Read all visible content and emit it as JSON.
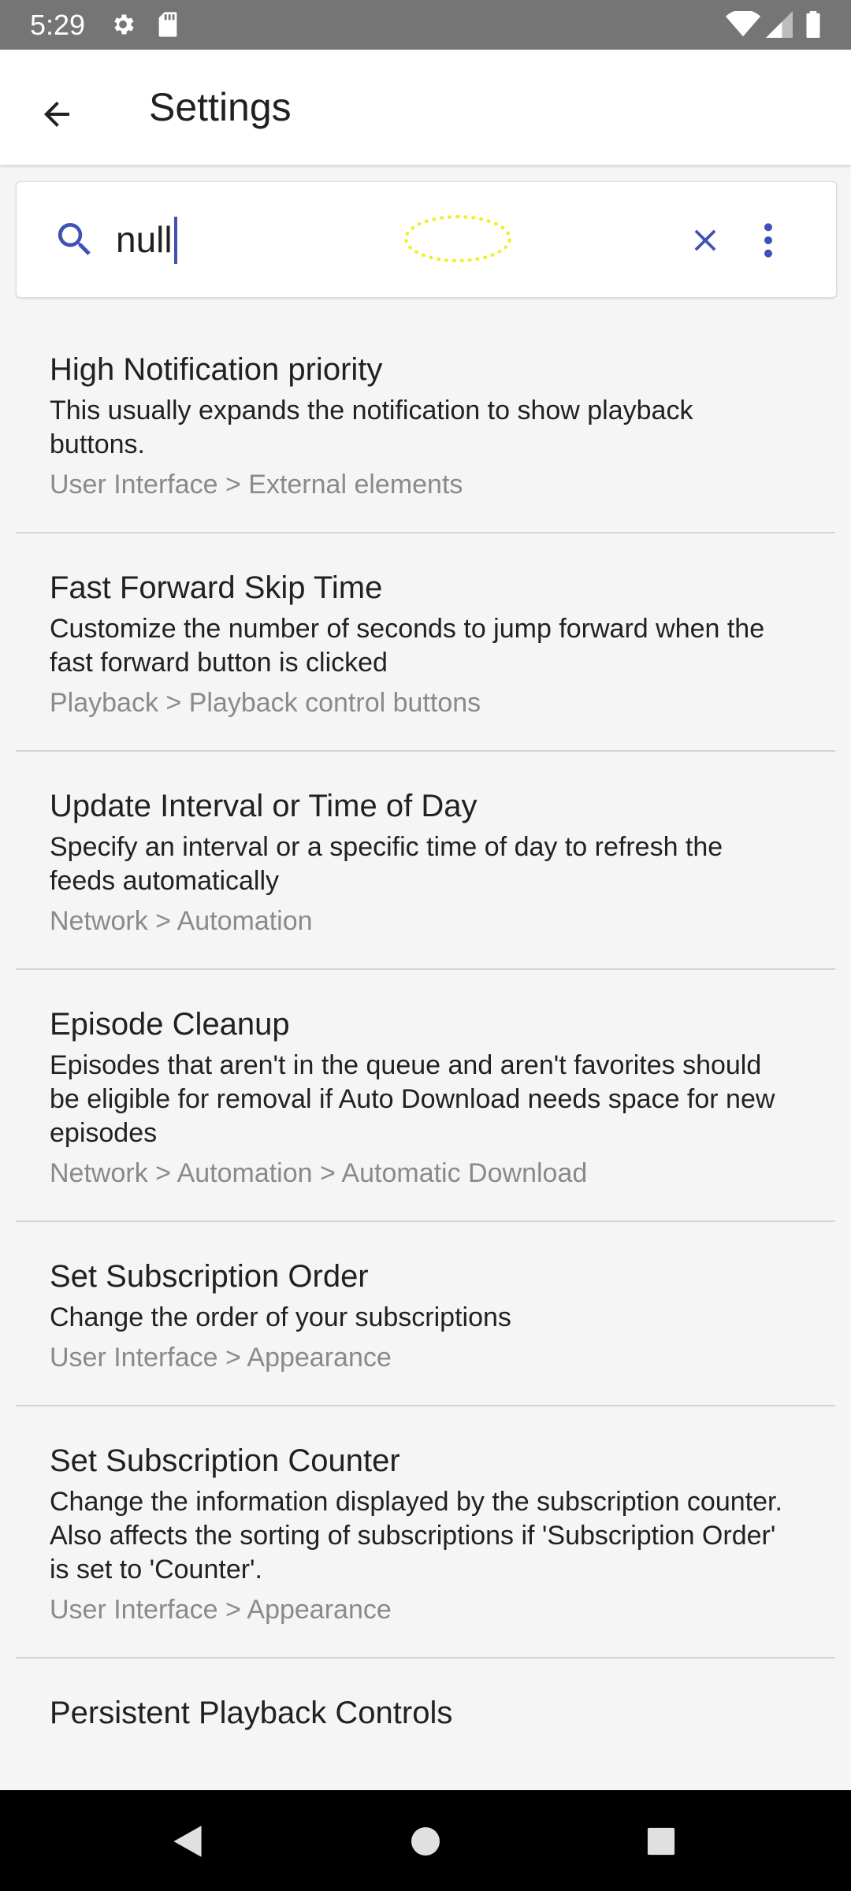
{
  "status_bar": {
    "time": "5:29",
    "icons": [
      "gear-icon",
      "sd-card-icon",
      "wifi-icon",
      "signal-icon",
      "battery-icon"
    ]
  },
  "app_bar": {
    "title": "Settings",
    "back_icon": "arrow-left-icon"
  },
  "search": {
    "value": "null",
    "icons": {
      "search": "search-icon",
      "clear": "close-icon",
      "more": "more-vert-icon"
    },
    "accent_color": "#3f51b5"
  },
  "results": [
    {
      "title": "High Notification priority",
      "summary": "This usually expands the notification to show playback buttons.",
      "path": "User Interface > External elements"
    },
    {
      "title": "Fast Forward Skip Time",
      "summary": "Customize the number of seconds to jump forward when the fast forward button is clicked",
      "path": "Playback > Playback control buttons"
    },
    {
      "title": "Update Interval or Time of Day",
      "summary": "Specify an interval or a specific time of day to refresh the feeds automatically",
      "path": "Network > Automation"
    },
    {
      "title": "Episode Cleanup",
      "summary": "Episodes that aren't in the queue and aren't favorites should be eligible for removal if Auto Download needs space for new episodes",
      "path": "Network > Automation > Automatic Download"
    },
    {
      "title": "Set Subscription Order",
      "summary": "Change the order of your subscriptions",
      "path": "User Interface > Appearance"
    },
    {
      "title": "Set Subscription Counter",
      "summary": "Change the information displayed by the subscription counter. Also affects the sorting of subscriptions if 'Subscription Order' is set to 'Counter'.",
      "path": "User Interface > Appearance"
    },
    {
      "title": "Persistent Playback Controls",
      "summary": "",
      "path": ""
    }
  ],
  "nav_bar": {
    "icons": [
      "nav-back-icon",
      "nav-home-icon",
      "nav-recents-icon"
    ]
  }
}
